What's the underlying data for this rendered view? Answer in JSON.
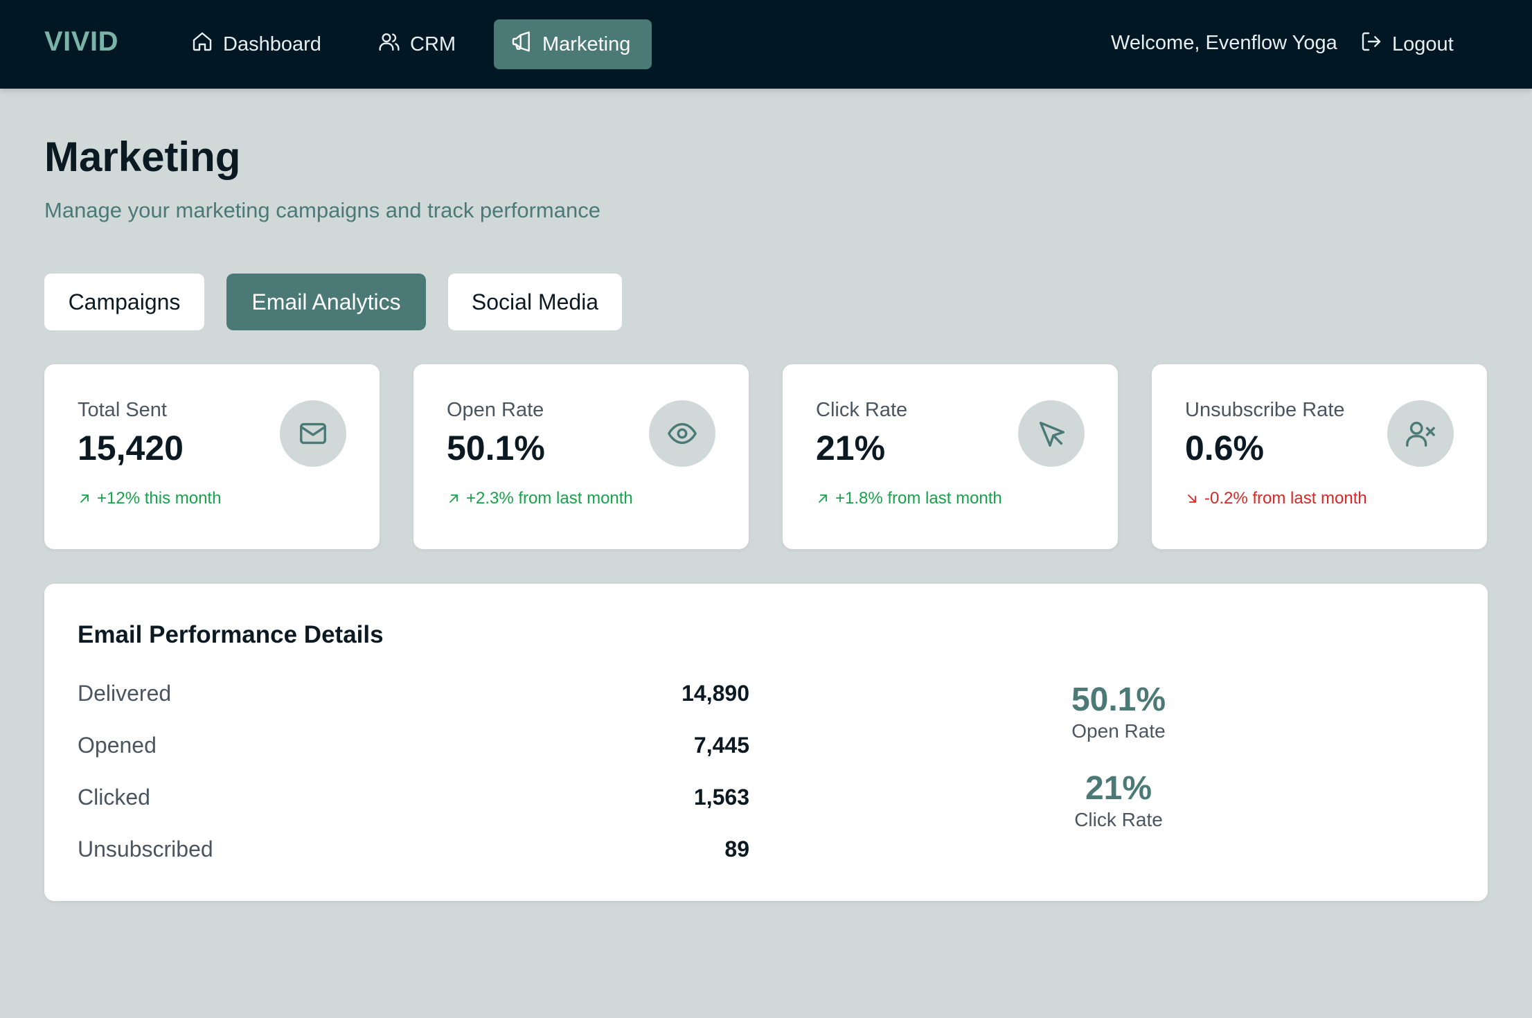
{
  "brand": "VIVID",
  "nav": {
    "items": [
      {
        "label": "Dashboard",
        "icon": "home-icon"
      },
      {
        "label": "CRM",
        "icon": "users-icon"
      },
      {
        "label": "Marketing",
        "icon": "megaphone-icon",
        "active": true
      }
    ],
    "welcome": "Welcome, Evenflow Yoga",
    "logout_label": "Logout"
  },
  "page": {
    "title": "Marketing",
    "subtitle": "Manage your marketing campaigns and track performance"
  },
  "tabs": [
    {
      "label": "Campaigns"
    },
    {
      "label": "Email Analytics",
      "active": true
    },
    {
      "label": "Social Media"
    }
  ],
  "stats": [
    {
      "label": "Total Sent",
      "value": "15,420",
      "change": "+12% this month",
      "trend": "up",
      "icon": "mail-icon"
    },
    {
      "label": "Open Rate",
      "value": "50.1%",
      "change": "+2.3% from last month",
      "trend": "up",
      "icon": "eye-icon"
    },
    {
      "label": "Click Rate",
      "value": "21%",
      "change": "+1.8% from last month",
      "trend": "up",
      "icon": "cursor-icon"
    },
    {
      "label": "Unsubscribe Rate",
      "value": "0.6%",
      "change": "-0.2% from last month",
      "trend": "down",
      "icon": "user-remove-icon"
    }
  ],
  "details": {
    "title": "Email Performance Details",
    "rows": [
      {
        "label": "Delivered",
        "value": "14,890"
      },
      {
        "label": "Opened",
        "value": "7,445"
      },
      {
        "label": "Clicked",
        "value": "1,563"
      },
      {
        "label": "Unsubscribed",
        "value": "89"
      }
    ],
    "summary": [
      {
        "value": "50.1%",
        "label": "Open Rate"
      },
      {
        "value": "21%",
        "label": "Click Rate"
      }
    ]
  },
  "colors": {
    "topbar": "#021724",
    "accent": "#4b7a76",
    "brand": "#7ab3a8",
    "background": "#d1d8d8",
    "trend_up": "#16a34a",
    "trend_down": "#dc2626"
  }
}
